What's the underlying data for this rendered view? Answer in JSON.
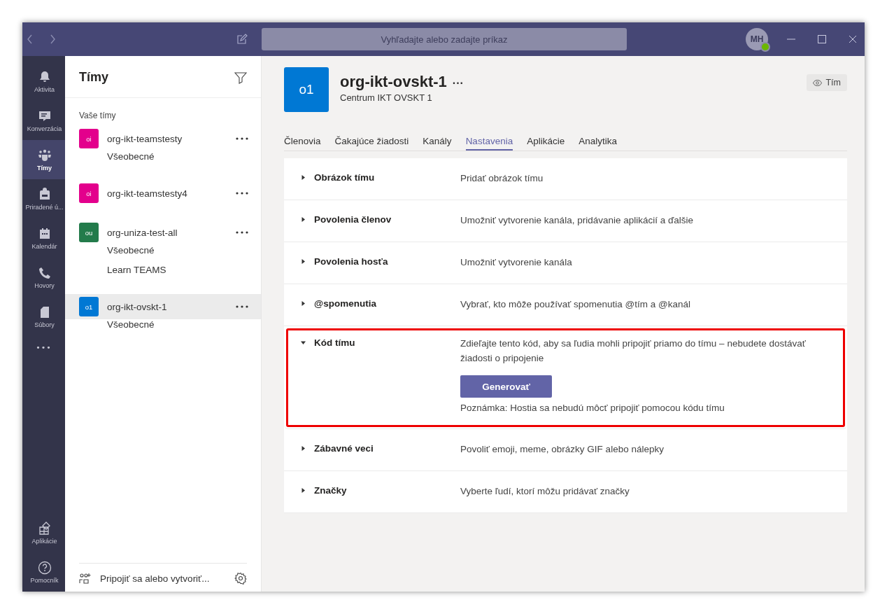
{
  "title_bar": {
    "search_placeholder": "Vyhľadajte alebo zadajte príkaz",
    "avatar_initials": "MH"
  },
  "rail": {
    "items": [
      {
        "label": "Aktivita",
        "kind": "bell",
        "selected": false
      },
      {
        "label": "Konverzácia",
        "kind": "chat",
        "selected": false
      },
      {
        "label": "Tímy",
        "kind": "teams",
        "selected": true
      },
      {
        "label": "Priradené ú...",
        "kind": "bag",
        "selected": false
      },
      {
        "label": "Kalendár",
        "kind": "calendar",
        "selected": false
      },
      {
        "label": "Hovory",
        "kind": "phone",
        "selected": false
      },
      {
        "label": "Súbory",
        "kind": "file",
        "selected": false
      }
    ],
    "more": "•••",
    "bottom": [
      {
        "label": "Aplikácie",
        "kind": "apps",
        "selected": false
      },
      {
        "label": "Pomocník",
        "kind": "help",
        "selected": false
      }
    ]
  },
  "teams_panel": {
    "title": "Tímy",
    "section": "Vaše tímy",
    "teams": [
      {
        "initials": "oi",
        "color": "#e3008c",
        "name": "org-ikt-teamstesty",
        "selected": false,
        "channels": [
          "Všeobecné"
        ]
      },
      {
        "initials": "oi",
        "color": "#e3008c",
        "name": "org-ikt-teamstesty4",
        "selected": false
      },
      {
        "initials": "ou",
        "color": "#237b4b",
        "name": "org-uniza-test-all",
        "selected": false,
        "channels": [
          "Všeobecné",
          "Learn TEAMS"
        ]
      },
      {
        "initials": "o1",
        "color": "#0078d4",
        "name": "org-ikt-ovskt-1",
        "selected": true,
        "channels": [
          "Všeobecné"
        ]
      }
    ],
    "footer": "Pripojiť sa alebo vytvoriť..."
  },
  "team_header": {
    "initials": "o1",
    "name": "org-ikt-ovskt-1",
    "more": "···",
    "subtitle": "Centrum IKT OVSKT 1",
    "view_button": "Tím"
  },
  "tabs": [
    {
      "label": "Členovia",
      "selected": false
    },
    {
      "label": "Čakajúce žiadosti",
      "selected": false
    },
    {
      "label": "Kanály",
      "selected": false
    },
    {
      "label": "Nastavenia",
      "selected": true
    },
    {
      "label": "Aplikácie",
      "selected": false
    },
    {
      "label": "Analytika",
      "selected": false
    }
  ],
  "settings": [
    {
      "title": "Obrázok tímu",
      "description": "Pridať obrázok tímu",
      "expanded": false,
      "highlighted": false
    },
    {
      "title": "Povolenia členov",
      "description": "Umožniť vytvorenie kanála, pridávanie aplikácií a ďalšie",
      "expanded": false,
      "highlighted": false
    },
    {
      "title": "Povolenia hosťa",
      "description": "Umožniť vytvorenie kanála",
      "expanded": false,
      "highlighted": false
    },
    {
      "title": "@spomenutia",
      "description": "Vybrať, kto môže používať spomenutia @tím a @kanál",
      "expanded": false,
      "highlighted": false
    },
    {
      "title": "Kód tímu",
      "description": "Zdieľajte tento kód, aby sa ľudia mohli pripojiť priamo do tímu – nebudete dostávať žiadosti o pripojenie",
      "expanded": true,
      "highlighted": true,
      "button": "Generovať",
      "note": "Poznámka: Hostia sa nebudú môcť pripojiť pomocou kódu tímu"
    },
    {
      "title": "Zábavné veci",
      "description": "Povoliť emoji, meme, obrázky GIF alebo nálepky",
      "expanded": false,
      "highlighted": false
    },
    {
      "title": "Značky",
      "description": "Vyberte ľudí, ktorí môžu pridávať značky",
      "expanded": false,
      "highlighted": false
    }
  ]
}
